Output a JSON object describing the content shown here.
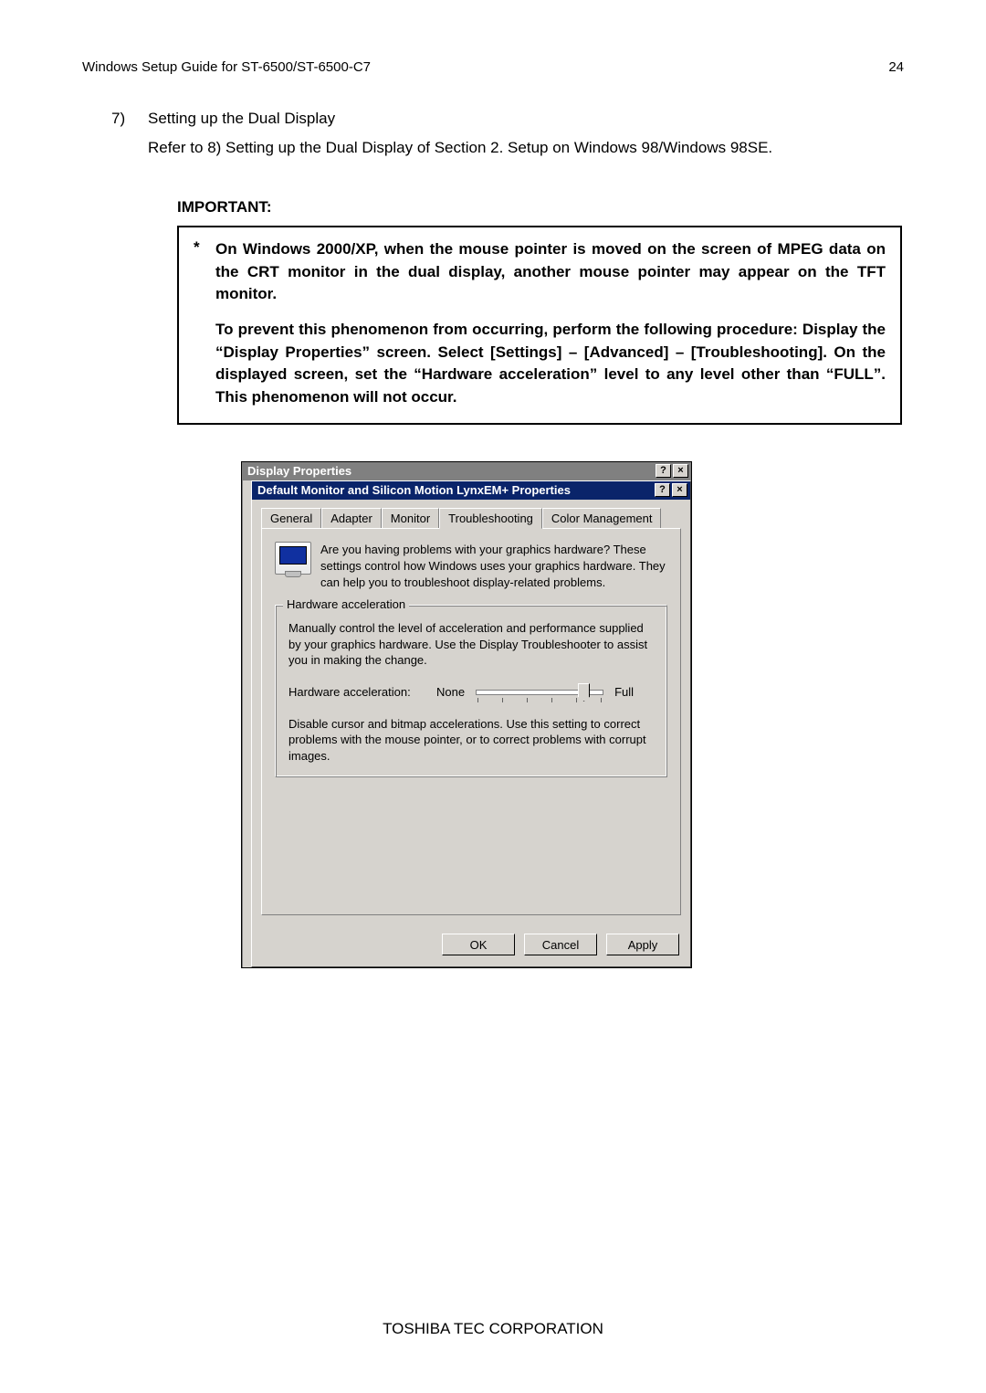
{
  "header": {
    "title": "Windows Setup Guide for ST-6500/ST-6500-C7",
    "page": "24"
  },
  "item7": {
    "num": "7)",
    "title": "Setting up the Dual Display"
  },
  "refer": "Refer to 8) Setting up the Dual Display of Section 2. Setup on Windows 98/Windows 98SE.",
  "important": {
    "heading": "IMPORTANT:",
    "star": "*",
    "p1": "On Windows 2000/XP, when the mouse pointer is moved on the screen of MPEG data on the CRT monitor in the dual display, another mouse pointer may appear on the TFT monitor.",
    "p2": "To prevent this phenomenon from occurring, perform the following procedure: Display the “Display Properties” screen.  Select [Settings] – [Advanced] – [Troubleshooting].  On the displayed screen, set the “Hardware acceleration” level to any level other than “FULL”.  This phenomenon will not occur."
  },
  "shot": {
    "outerTitle": "Display Properties",
    "innerTitle": "Default Monitor and Silicon Motion LynxEM+ Properties",
    "helpGlyph": "?",
    "closeGlyph": "×",
    "tabs": {
      "general": "General",
      "adapter": "Adapter",
      "monitor": "Monitor",
      "troubleshooting": "Troubleshooting",
      "colormgmt": "Color Management"
    },
    "intro": "Are you having problems with your graphics hardware? These settings control how Windows uses your graphics hardware. They can help you to troubleshoot display-related problems.",
    "group": {
      "legend": "Hardware acceleration",
      "desc": "Manually control the level of acceleration and performance supplied by your graphics hardware. Use the Display Troubleshooter to assist you in making the change.",
      "label": "Hardware acceleration:",
      "min": "None",
      "max": "Full",
      "help": "Disable cursor and bitmap accelerations. Use this setting to correct problems with the mouse pointer, or to correct problems with corrupt images."
    },
    "buttons": {
      "ok": "OK",
      "cancel": "Cancel",
      "apply": "Apply"
    }
  },
  "footer": "TOSHIBA TEC CORPORATION"
}
